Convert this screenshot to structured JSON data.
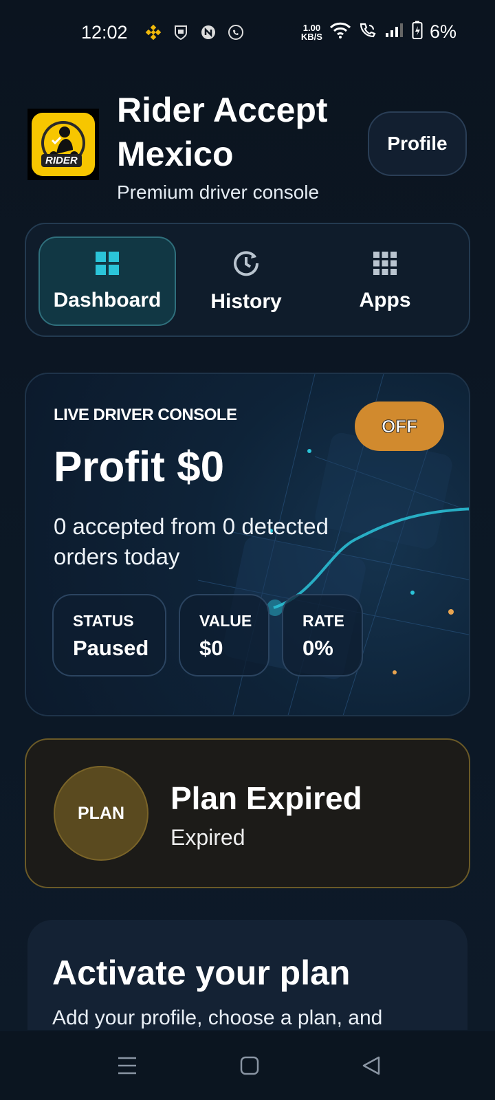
{
  "status_bar": {
    "time": "12:02",
    "net_speed_value": "1.00",
    "net_speed_unit": "KB/S",
    "battery": "6%"
  },
  "header": {
    "logo_text": "RIDER",
    "title": "Rider Accept Mexico",
    "subtitle": "Premium driver console",
    "profile_label": "Profile"
  },
  "nav": {
    "tabs": [
      {
        "label": "Dashboard",
        "icon": "dashboard-icon",
        "active": true
      },
      {
        "label": "History",
        "icon": "history-icon",
        "active": false
      },
      {
        "label": "Apps",
        "icon": "apps-grid-icon",
        "active": false
      }
    ]
  },
  "console": {
    "label": "LIVE DRIVER CONSOLE",
    "toggle_label": "OFF",
    "profit": "Profit $0",
    "summary": "0 accepted from 0 detected orders today",
    "stats": [
      {
        "key": "STATUS",
        "value": "Paused"
      },
      {
        "key": "VALUE",
        "value": "$0"
      },
      {
        "key": "RATE",
        "value": "0%"
      }
    ]
  },
  "plan": {
    "badge": "PLAN",
    "title": "Plan Expired",
    "status": "Expired"
  },
  "activate": {
    "title": "Activate your plan",
    "description": "Add your profile, choose a plan, and"
  },
  "colors": {
    "accent_teal": "#2bc4d9",
    "off_button": "#d18a2e",
    "plan_gold": "#6b5a27"
  }
}
